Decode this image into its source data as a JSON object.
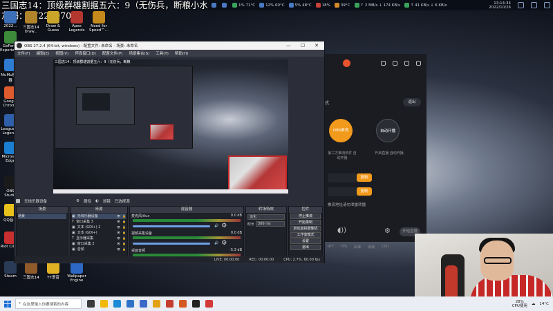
{
  "overlay": {
    "title": "三国志14：顶级群雄割据五六：9（无伤兵，断粮小水友喝：972259706"
  },
  "monitor": {
    "items": [
      {
        "icon": "display-icon",
        "color": "#4a78c2",
        "text": ""
      },
      {
        "icon": "speaker-icon",
        "color": "#4a78c2",
        "text": ""
      },
      {
        "icon": "cpu-temp-icon",
        "color": "#3aa35b",
        "text": "1% 71°C"
      },
      {
        "icon": "gpu-icon",
        "color": "#4a78c2",
        "text": "12% 60°C"
      },
      {
        "icon": "ram-icon",
        "color": "#4a78c2",
        "text": "5% 48°C"
      },
      {
        "icon": "disk-icon",
        "color": "#c8433a",
        "text": "18%"
      },
      {
        "icon": "hdd-icon",
        "color": "#d58a2b",
        "text": "39°C"
      },
      {
        "icon": "net-icon",
        "color": "#3aa35b",
        "text": "↑ 2 MB/s ↓ 174 KB/s"
      },
      {
        "icon": "net2-icon",
        "color": "#3aa35b",
        "text": "↑ 41 KB/s ↓ 6 KB/s"
      }
    ],
    "time": "13:14:34",
    "date": "2022/10/26"
  },
  "desktop_icons": [
    {
      "name": "icon-top-1",
      "label": "2022..."
    },
    {
      "name": "icon-top-2",
      "label": "三国志14 Draw..."
    },
    {
      "name": "icon-top-3",
      "label": "Draw & Guess"
    },
    {
      "name": "icon-top-4",
      "label": "Apex Legends"
    },
    {
      "name": "icon-top-5",
      "label": "Need for Speed™..."
    },
    {
      "name": "icon-left-1",
      "label": "GeForce Experience"
    },
    {
      "name": "icon-left-2",
      "label": "MuMu模拟器"
    },
    {
      "name": "icon-left-3",
      "label": "Google Chrome"
    },
    {
      "name": "icon-left-4",
      "label": "League of Legends"
    },
    {
      "name": "icon-left-5",
      "label": "Microsoft Edge"
    },
    {
      "name": "icon-left-6",
      "label": "OBS Studio"
    },
    {
      "name": "icon-left-7",
      "label": "QQ音乐"
    },
    {
      "name": "icon-left-8",
      "label": "Riot Client"
    },
    {
      "name": "icon-bottom-1",
      "label": "Steam"
    },
    {
      "name": "icon-bottom-2",
      "label": "三国志14"
    },
    {
      "name": "icon-bottom-3",
      "label": "YY语音"
    },
    {
      "name": "icon-bottom-4",
      "label": "Wallpaper Engine"
    }
  ],
  "obs": {
    "title": "OBS 27.2.4 (64-bit, windows) - 配置文件: 未命名 - 场景: 未命名",
    "menu": [
      "文件(F)",
      "编辑(E)",
      "视图(V)",
      "停靠窗口(D)",
      "配置文件(P)",
      "场景集合(S)",
      "工具(T)",
      "帮助(H)"
    ],
    "preview_text": "三国志14：顶级群雄割据五六：9（无伤兵，断粮",
    "scene_bar": {
      "scene": "无线乐器设备",
      "properties": "属性",
      "filters": "滤镜",
      "source_label": "已选择源"
    },
    "docks": {
      "scenes": {
        "title": "场景",
        "items": [
          "场景"
        ]
      },
      "sources": {
        "title": "来源",
        "items": [
          "无线乐器设备",
          "窗口采集 3",
          "文本 (GDI+) 2",
          "文本 (GDI+)",
          "显示器采集",
          "窗口采集 2",
          "音频"
        ]
      },
      "mixer": {
        "title": "混音器",
        "tracks": [
          {
            "name": "麦克风/Aux",
            "db": "0.0 dB"
          },
          {
            "name": "视频采集设备",
            "db": "0.0 dB"
          },
          {
            "name": "桌面音频",
            "db": "-5.3 dB"
          }
        ]
      },
      "transitions": {
        "title": "转场特效",
        "selected": "淡化",
        "duration_label": "时长",
        "duration": "300 ms"
      },
      "controls": {
        "title": "控件",
        "buttons": [
          "停止推流",
          "开始录制",
          "启动虚拟摄像机",
          "工作室模式",
          "设置",
          "退出"
        ]
      }
    },
    "status": {
      "live": "LIVE: 00:00:00",
      "rec": "REC: 00:00:00",
      "cpu": "CPU: 2.7%, 60.00 fps"
    }
  },
  "live_app": {
    "version_link": "式",
    "exit_label": "退出",
    "mode_obs_label": "OBS推流",
    "mode_auto_label": "自动开播",
    "mode_obs_desc": "第三方推流软件 自动开播",
    "mode_auto_desc": "开启直播 自动开播",
    "copy_label": "复制",
    "hint": "推流地址请勿泄露转播",
    "start_label": "开始直播",
    "stats": [
      "RTT",
      "FPS",
      "码率",
      "丢帧",
      "CPU"
    ]
  },
  "taskbar": {
    "search_placeholder": "在这里输入你要搜索的内容",
    "cpu_usage": "28%",
    "cpu_label": "CPU使用",
    "temperature": "14°C",
    "apps": [
      {
        "name": "task-view-icon",
        "color": "#3a3a3a"
      },
      {
        "name": "file-explorer-icon",
        "color": "#f2b90c"
      },
      {
        "name": "edge-icon",
        "color": "#1a8bd6"
      },
      {
        "name": "mail-icon",
        "color": "#2f72c8"
      },
      {
        "name": "store-icon",
        "color": "#3b68c9"
      },
      {
        "name": "chrome-icon",
        "color": "#e3a216"
      },
      {
        "name": "photos-icon",
        "color": "#c43d2f"
      },
      {
        "name": "game-icon",
        "color": "#d55a22"
      },
      {
        "name": "obs-icon",
        "color": "#222222"
      },
      {
        "name": "app-red-icon",
        "color": "#d23a3a"
      }
    ]
  }
}
